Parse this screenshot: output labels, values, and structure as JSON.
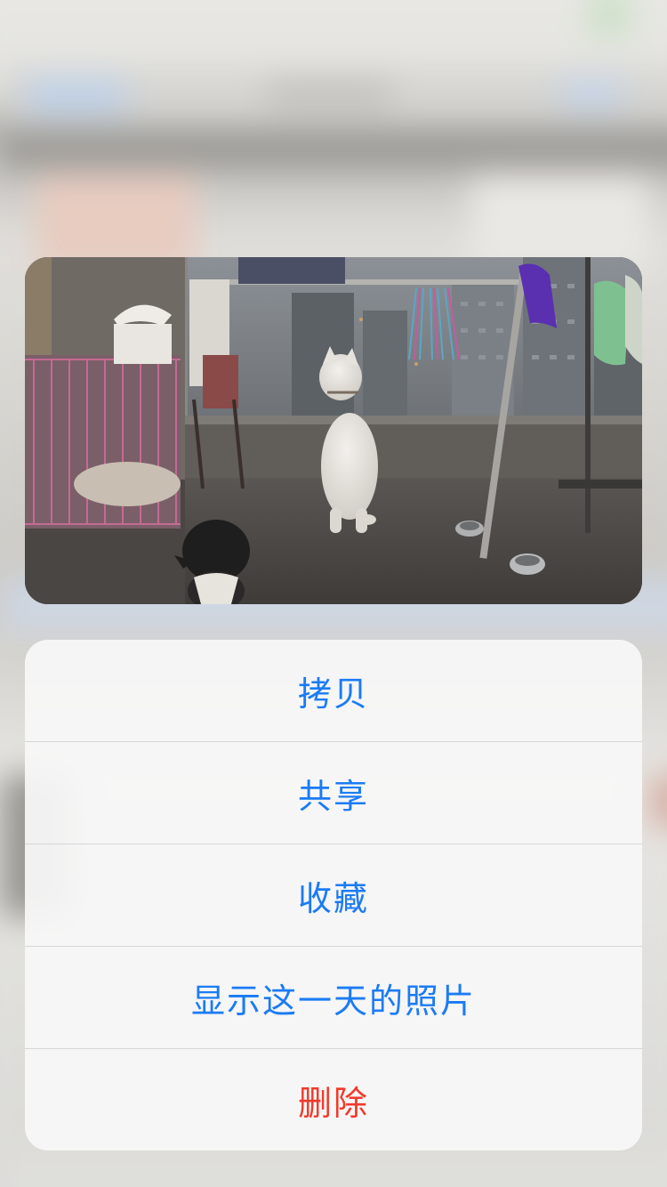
{
  "actions": [
    {
      "id": "copy",
      "label": "拷贝",
      "style": "default"
    },
    {
      "id": "share",
      "label": "共享",
      "style": "default"
    },
    {
      "id": "favorite",
      "label": "收藏",
      "style": "default"
    },
    {
      "id": "show-day",
      "label": "显示这一天的照片",
      "style": "default"
    },
    {
      "id": "delete",
      "label": "删除",
      "style": "destructive"
    }
  ],
  "colors": {
    "action_blue": "#1b7bf5",
    "destructive_red": "#f2392b",
    "sheet_background": "#f7f7f7"
  }
}
